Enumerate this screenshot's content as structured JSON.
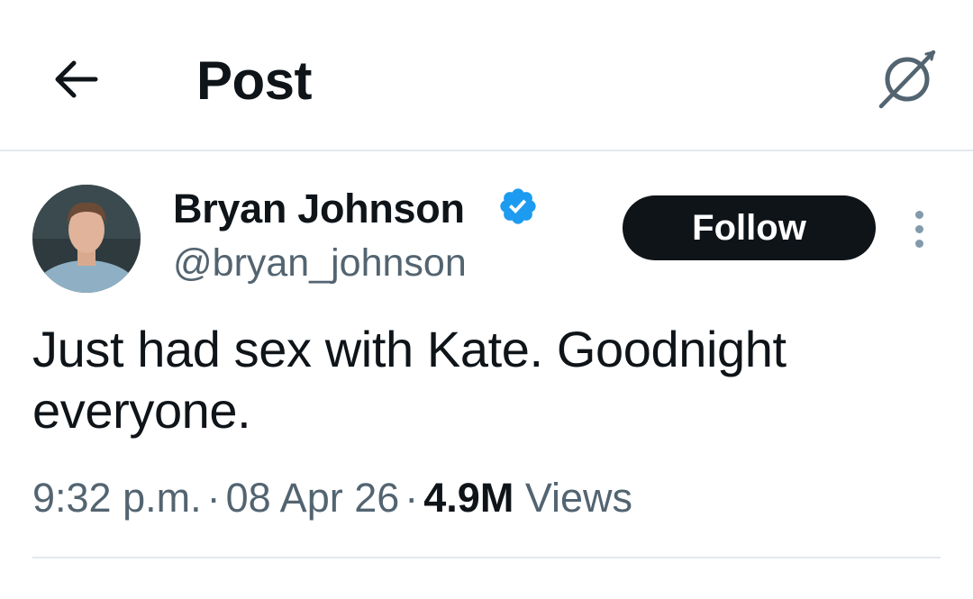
{
  "header": {
    "title": "Post",
    "back_icon": "arrow-left-icon",
    "grok_icon": "grok-icon"
  },
  "author": {
    "name": "Bryan Johnson",
    "handle": "@bryan_johnson",
    "verified": true,
    "verified_color": "#1d9bf0"
  },
  "actions": {
    "follow_label": "Follow",
    "more_icon": "more-vertical-icon"
  },
  "post": {
    "text": "Just had sex with Kate. Goodnight everyone.",
    "time": "9:32 p.m.",
    "separator": "·",
    "date": "08 Apr 26",
    "views_count": "4.9M",
    "views_label": "Views"
  },
  "colors": {
    "primary_text": "#0f1419",
    "secondary_text": "#536471",
    "divider": "#e3e8ec",
    "follow_bg": "#0f1419"
  }
}
